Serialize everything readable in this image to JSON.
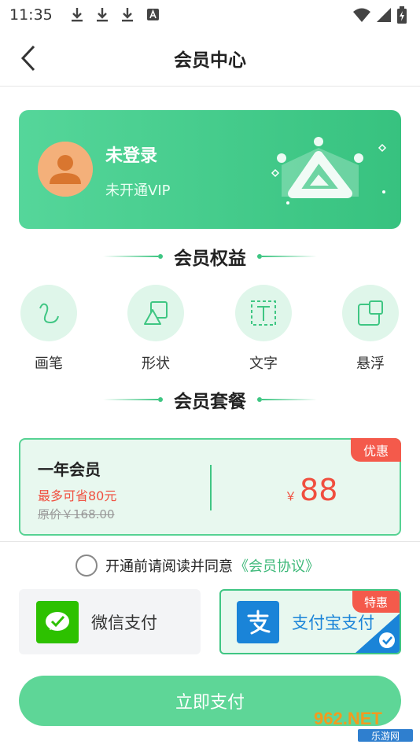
{
  "status_bar": {
    "time": "11:35",
    "icons": [
      "download-icon",
      "download-icon",
      "download-icon",
      "a-icon",
      "wifi-icon",
      "signal-icon",
      "battery-icon"
    ]
  },
  "header": {
    "back_icon": "chevron-left-icon",
    "title": "会员中心"
  },
  "vip_card": {
    "user_name": "未登录",
    "vip_status": "未开通VIP",
    "avatar_icon": "user-avatar-icon",
    "decor_icon": "crown-icon",
    "colors": {
      "from": "#55d69a",
      "to": "#37c27f"
    }
  },
  "benefits": {
    "title": "会员权益",
    "items": [
      {
        "label": "画笔",
        "icon": "brush-icon"
      },
      {
        "label": "形状",
        "icon": "shape-icon"
      },
      {
        "label": "文字",
        "icon": "text-icon"
      },
      {
        "label": "悬浮",
        "icon": "float-window-icon"
      }
    ]
  },
  "packages": {
    "title": "会员套餐",
    "plan": {
      "name": "一年会员",
      "save_text": "最多可省80元",
      "original_price": "原价￥168.00",
      "currency": "￥",
      "price": "88",
      "badge": "优惠"
    }
  },
  "agreement": {
    "text": "开通前请阅读并同意",
    "link": "《会员协议》",
    "checked": false
  },
  "payment": {
    "options": [
      {
        "label": "微信支付",
        "icon": "wechat-pay-icon",
        "selected": false
      },
      {
        "label": "支付宝支付",
        "icon": "alipay-icon",
        "selected": true,
        "badge": "特惠"
      }
    ]
  },
  "pay_button": {
    "label": "立即支付"
  },
  "watermark": {
    "text": "962.NET",
    "subtext": "乐游网"
  },
  "colors": {
    "accent": "#3fc683",
    "price": "#f04f3f",
    "badge": "#f45a4b",
    "alipay": "#1a84d8",
    "wechat": "#2dc100"
  }
}
